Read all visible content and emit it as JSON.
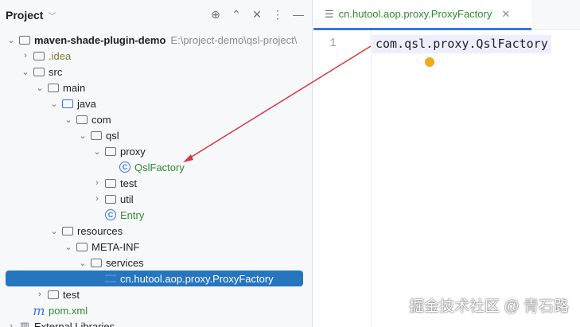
{
  "panel": {
    "title": "Project"
  },
  "tree": [
    {
      "label": "maven-shade-plugin-demo",
      "hint": "E:\\project-demo\\qsl-project\\",
      "level": 0,
      "exp": "open",
      "icon": "module-folder",
      "style": "bold"
    },
    {
      "label": ".idea",
      "level": 1,
      "exp": "closed",
      "icon": "folder",
      "style": "olive"
    },
    {
      "label": "src",
      "level": 1,
      "exp": "open",
      "icon": "folder"
    },
    {
      "label": "main",
      "level": 2,
      "exp": "open",
      "icon": "folder"
    },
    {
      "label": "java",
      "level": 3,
      "exp": "open",
      "icon": "source-folder"
    },
    {
      "label": "com",
      "level": 4,
      "exp": "open",
      "icon": "package"
    },
    {
      "label": "qsl",
      "level": 5,
      "exp": "open",
      "icon": "package"
    },
    {
      "label": "proxy",
      "level": 6,
      "exp": "open",
      "icon": "package"
    },
    {
      "label": "QslFactory",
      "level": 7,
      "exp": "none",
      "icon": "class",
      "style": "green"
    },
    {
      "label": "test",
      "level": 6,
      "exp": "closed",
      "icon": "package"
    },
    {
      "label": "util",
      "level": 6,
      "exp": "closed",
      "icon": "package"
    },
    {
      "label": "Entry",
      "level": 6,
      "exp": "none",
      "icon": "class",
      "style": "green"
    },
    {
      "label": "resources",
      "level": 3,
      "exp": "open",
      "icon": "resources-folder"
    },
    {
      "label": "META-INF",
      "level": 4,
      "exp": "open",
      "icon": "folder"
    },
    {
      "label": "services",
      "level": 5,
      "exp": "open",
      "icon": "folder"
    },
    {
      "label": "cn.hutool.aop.proxy.ProxyFactory",
      "level": 6,
      "exp": "none",
      "icon": "text-file",
      "selected": true
    },
    {
      "label": "test",
      "level": 2,
      "exp": "closed",
      "icon": "folder"
    },
    {
      "label": "pom.xml",
      "level": 1,
      "exp": "none",
      "icon": "maven",
      "style": "green"
    },
    {
      "label": "External Libraries",
      "level": 0,
      "exp": "closed",
      "icon": "library"
    }
  ],
  "editor": {
    "tab": "cn.hutool.aop.proxy.ProxyFactory",
    "line_number": "1",
    "code": "com.qsl.proxy.QslFactory"
  },
  "watermark": "掘金技术社区 @ 青石路"
}
